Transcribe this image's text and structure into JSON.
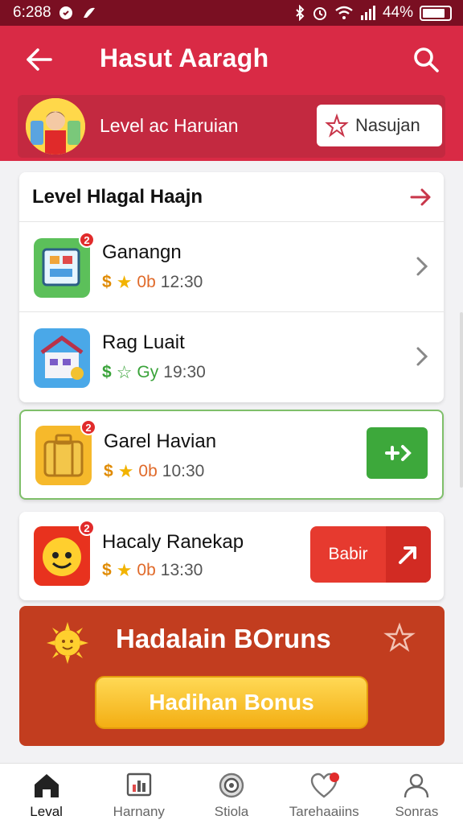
{
  "status_bar": {
    "time": "6:288",
    "battery": "44%"
  },
  "header": {
    "title": "Hasut Aaragh",
    "profile_label": "Level ac Haruian",
    "profile_button_label": "Nasujan"
  },
  "list_card": {
    "title": "Level Hlagal Haajn",
    "items": [
      {
        "title": "Ganangn",
        "meta_coin": "$",
        "meta_value": "0b",
        "meta_time": "12:30",
        "badge": "2"
      },
      {
        "title": "Rag Luait",
        "meta_coin": "$",
        "meta_value": "Gy",
        "meta_time": "19:30",
        "badge": ""
      }
    ]
  },
  "highlight_item": {
    "title": "Garel Havian",
    "meta_coin": "$",
    "meta_value": "0b",
    "meta_time": "10:30",
    "badge": "2"
  },
  "sun_item": {
    "title": "Hacaly Ranekap",
    "meta_coin": "$",
    "meta_value": "0b",
    "meta_time": "13:30",
    "badge": "2",
    "action_label": "Babir"
  },
  "bonus": {
    "title": "Hadalain BOruns",
    "button_label": "Hadihan Bonus"
  },
  "bottom_nav": {
    "items": [
      {
        "label": "Leval",
        "icon": "home-icon"
      },
      {
        "label": "Harnany",
        "icon": "stats-icon"
      },
      {
        "label": "Stiola",
        "icon": "target-icon"
      },
      {
        "label": "Tarehaaiins",
        "icon": "heart-icon"
      },
      {
        "label": "Sonras",
        "icon": "profile-icon"
      }
    ]
  },
  "colors": {
    "primary_red": "#d92a45",
    "status_bar": "#7a0f22",
    "bonus_bg": "#c23d1f",
    "green_accent": "#3da83b",
    "gold_button": "#f3ae13"
  }
}
